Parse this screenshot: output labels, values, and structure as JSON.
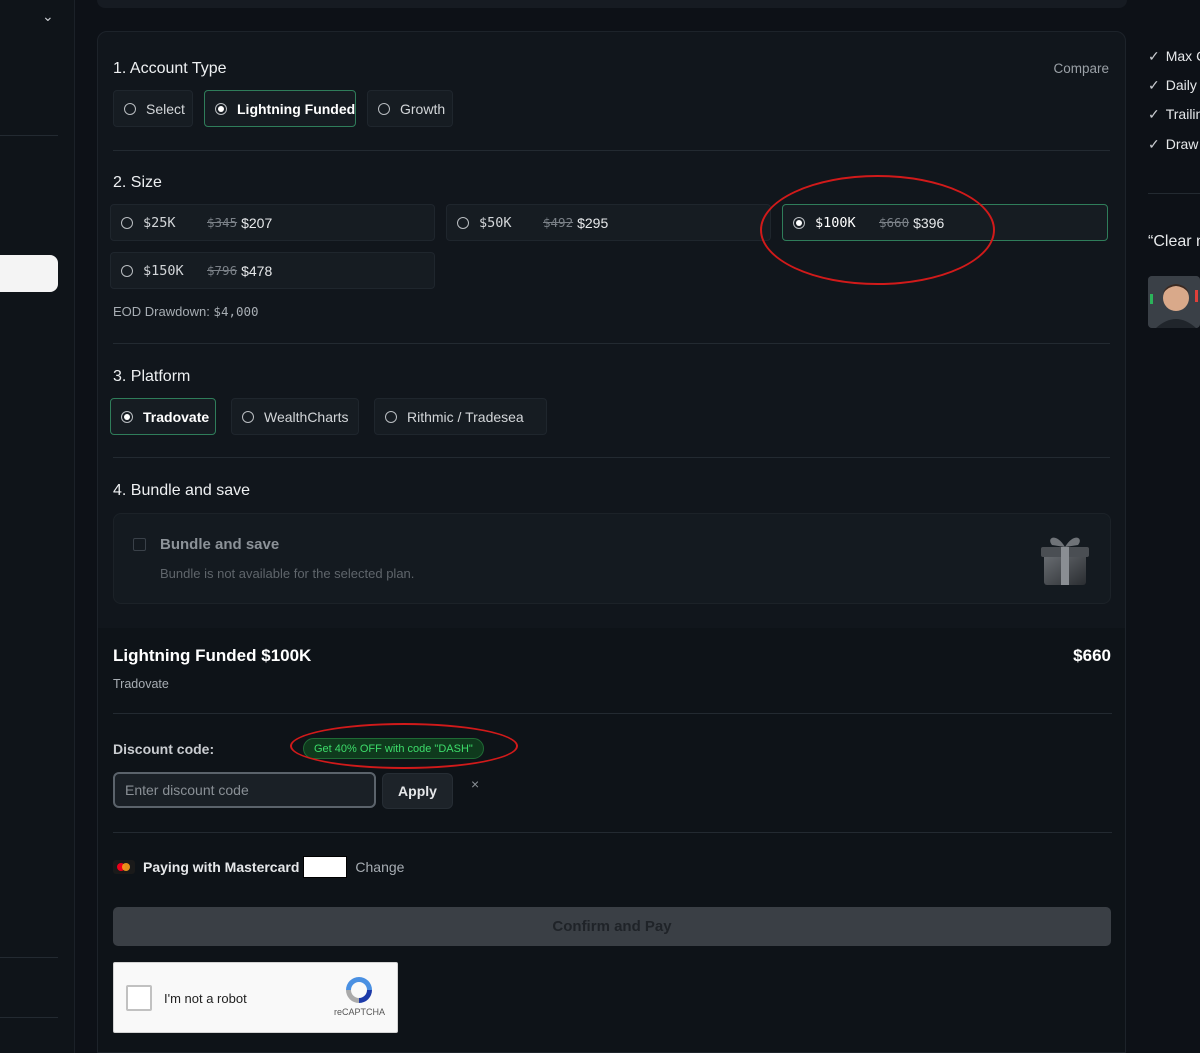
{
  "account_type": {
    "title": "1. Account Type",
    "compare": "Compare",
    "options": [
      "Select",
      "Lightning Funded",
      "Growth"
    ],
    "selected": "Lightning Funded"
  },
  "size": {
    "title": "2. Size",
    "options": [
      {
        "label": "$25K",
        "old_price": "$345",
        "price": "$207"
      },
      {
        "label": "$50K",
        "old_price": "$492",
        "price": "$295"
      },
      {
        "label": "$100K",
        "old_price": "$660",
        "price": "$396"
      },
      {
        "label": "$150K",
        "old_price": "$796",
        "price": "$478"
      }
    ],
    "selected": "$100K",
    "eod_label": "EOD Drawdown: ",
    "eod_value": "$4,000"
  },
  "platform": {
    "title": "3. Platform",
    "options": [
      "Tradovate",
      "WealthCharts",
      "Rithmic / Tradesea"
    ],
    "selected": "Tradovate"
  },
  "bundle": {
    "title": "4. Bundle and save",
    "box_title": "Bundle and save",
    "box_subtitle": "Bundle is not available for the selected plan."
  },
  "summary": {
    "plan": "Lightning Funded $100K",
    "platform": "Tradovate",
    "price": "$660",
    "discount_label": "Discount code:",
    "promo": "Get 40% OFF with code \"DASH\"",
    "discount_placeholder": "Enter discount code",
    "apply": "Apply",
    "clear": "×",
    "paying_with": "Paying with Mastercard",
    "change": "Change",
    "confirm": "Confirm and Pay"
  },
  "captcha": {
    "label": "I'm not a robot",
    "brand": "reCAPTCHA"
  },
  "right_panel": {
    "checks": [
      "Max C",
      "Daily",
      "Trailin",
      "Draw"
    ],
    "quote": "“Clear n"
  },
  "colors": {
    "accent_green": "#2f7d5a",
    "promo_green": "#3ddc6a",
    "annotation_red": "#d11a1a"
  }
}
